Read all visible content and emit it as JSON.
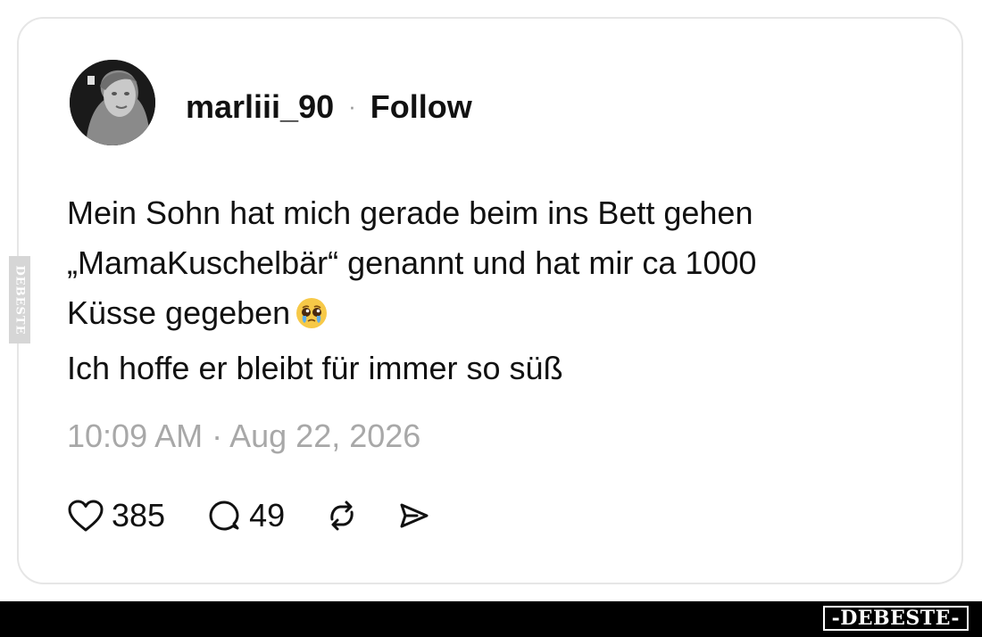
{
  "post": {
    "username": "marliii_90",
    "separator": "·",
    "follow_label": "Follow",
    "text_lines": [
      "Mein Sohn hat mich gerade beim ins Bett gehen",
      "„MamaKuschelbär“ genannt und hat mir ca 1000",
      "Küsse gegeben",
      "Ich hoffe er bleibt für immer so süß"
    ],
    "emoji": "pleading-face-with-tears",
    "timestamp": "10:09 AM · Aug 22, 2026"
  },
  "actions": {
    "likes": "385",
    "comments": "49",
    "icons": [
      "heart-icon",
      "comment-icon",
      "repost-icon",
      "share-icon"
    ]
  },
  "watermark": {
    "side_text": "DEBESTE",
    "footer_logo": "-DEBESTE-"
  },
  "colors": {
    "text": "#111111",
    "muted": "#a8a8a8",
    "card_border": "#e6e6e6",
    "footer": "#000000"
  }
}
